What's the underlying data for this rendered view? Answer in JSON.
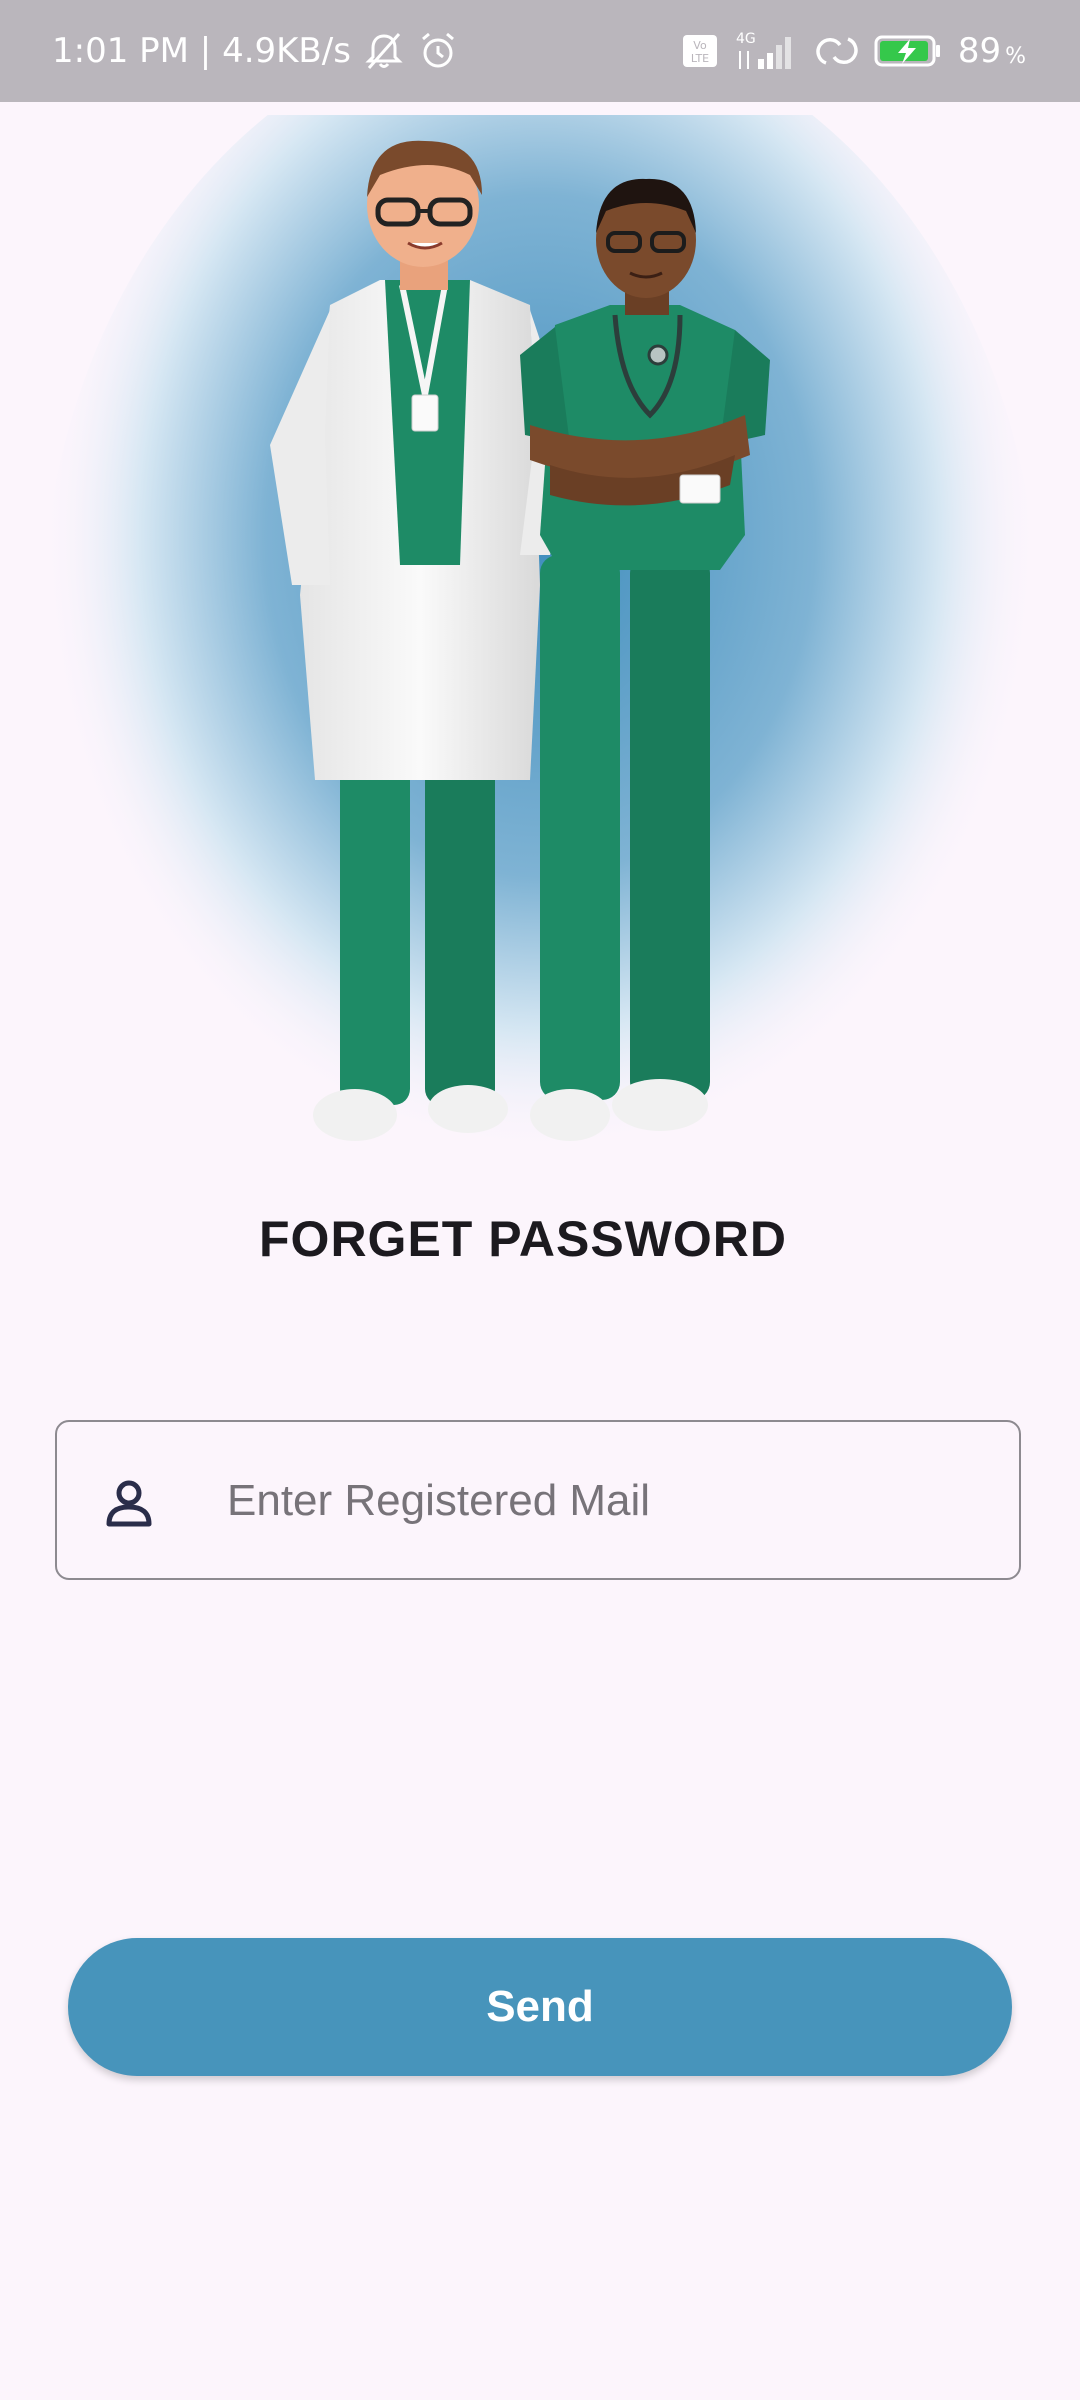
{
  "status_bar": {
    "time_speed": "1:01 PM | 4.9KB/s",
    "network_type": "4G",
    "volte": "Vo\nLTE",
    "battery_level": "89",
    "battery_unit": "%",
    "icons": [
      "mute-bell-icon",
      "alarm-icon",
      "volte-icon",
      "signal-icon",
      "hotspot-icon",
      "battery-charging-icon"
    ]
  },
  "hero": {
    "image": "two-doctors-illustration"
  },
  "page": {
    "title": "FORGET PASSWORD"
  },
  "form": {
    "email_placeholder": "Enter Registered Mail",
    "email_value": "",
    "email_icon": "person-icon"
  },
  "actions": {
    "send_label": "Send"
  },
  "colors": {
    "background": "#fcf5fc",
    "status_bar": "#bab6bc",
    "accent": "#4794bb",
    "scrubs_green": "#1e8b66"
  }
}
